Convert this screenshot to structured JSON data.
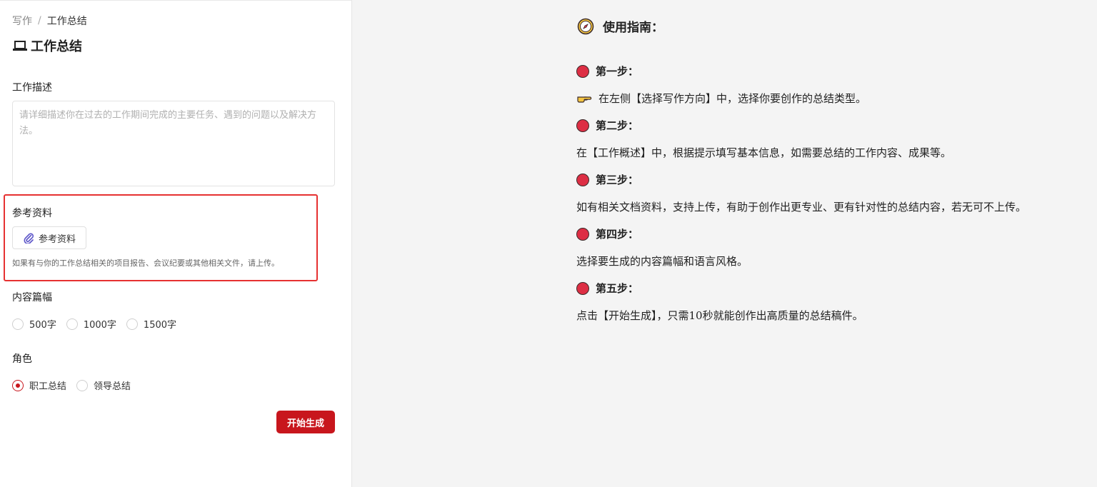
{
  "breadcrumb": {
    "parent": "写作",
    "separator": "/",
    "current": "工作总结"
  },
  "page": {
    "title": "工作总结",
    "icon": "laptop-icon"
  },
  "form": {
    "description": {
      "label": "工作描述",
      "value": "",
      "placeholder": "请详细描述你在过去的工作期间完成的主要任务、遇到的问题以及解决方法。"
    },
    "reference": {
      "label": "参考资料",
      "button_label": "参考资料",
      "button_icon": "paperclip-icon",
      "hint": "如果有与你的工作总结相关的项目报告、会议纪要或其他相关文件，请上传。"
    },
    "length": {
      "label": "内容篇幅",
      "options": [
        "500字",
        "1000字",
        "1500字"
      ],
      "selected": null
    },
    "role": {
      "label": "角色",
      "options": [
        "职工总结",
        "领导总结"
      ],
      "selected": "职工总结"
    },
    "submit_label": "开始生成"
  },
  "guide": {
    "title": "使用指南：",
    "title_icon": "compass-icon",
    "step_icon": "red-circle-icon",
    "steps": [
      {
        "heading": "第一步：",
        "text": "在左侧【选择写作方向】中，选择你要创作的总结类型。",
        "text_icon": "pointing-hand-icon"
      },
      {
        "heading": "第二步：",
        "text": "在【工作概述】中，根据提示填写基本信息，如需要总结的工作内容、成果等。"
      },
      {
        "heading": "第三步：",
        "text": "如有相关文档资料，支持上传，有助于创作出更专业、更有针对性的总结内容，若无可不上传。"
      },
      {
        "heading": "第四步：",
        "text": "选择要生成的内容篇幅和语言风格。"
      },
      {
        "heading": "第五步：",
        "text": "点击【开始生成】，只需10秒就能创作出高质量的总结稿件。"
      }
    ]
  },
  "colors": {
    "accent": "#c8161d",
    "highlight_border": "#e63131",
    "step_dot": "#dd2e44",
    "panel_bg": "#f4f4f4"
  }
}
